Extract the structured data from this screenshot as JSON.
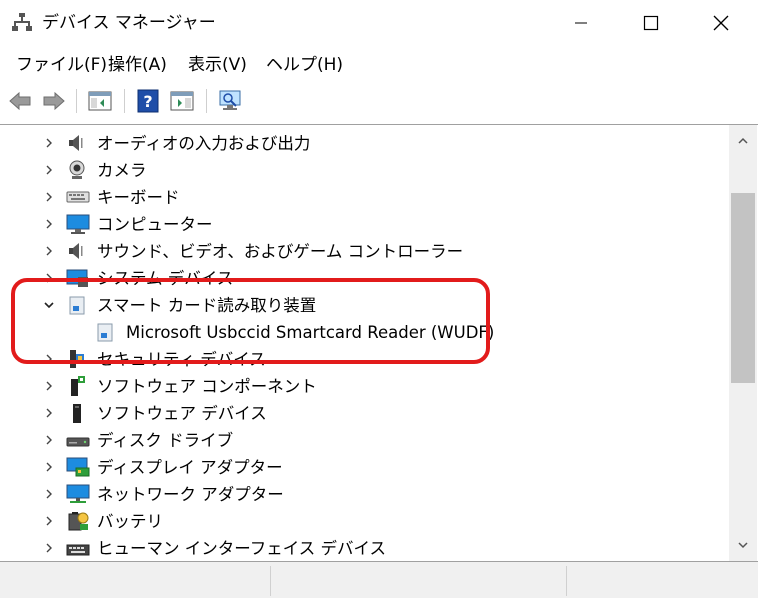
{
  "window": {
    "title": "デバイス マネージャー"
  },
  "menu": [
    {
      "label": "ファイル(F)"
    },
    {
      "label": "操作(A)"
    },
    {
      "label": "表示(V)"
    },
    {
      "label": "ヘルプ(H)"
    }
  ],
  "toolbar": {
    "buttons": [
      {
        "icon": "back-arrow-icon"
      },
      {
        "icon": "forward-arrow-icon"
      },
      {
        "icon": "show-hide-console-tree-icon"
      },
      {
        "icon": "help-icon"
      },
      {
        "icon": "action-pane-icon"
      },
      {
        "icon": "scan-hardware-changes-icon"
      }
    ]
  },
  "tree": {
    "items": [
      {
        "label": "オーディオの入力および出力",
        "icon": "speaker-icon",
        "expanded": false
      },
      {
        "label": "カメラ",
        "icon": "webcam-icon",
        "expanded": false
      },
      {
        "label": "キーボード",
        "icon": "keyboard-icon",
        "expanded": false
      },
      {
        "label": "コンピューター",
        "icon": "monitor-icon",
        "expanded": false
      },
      {
        "label": "サウンド、ビデオ、およびゲーム コントローラー",
        "icon": "speaker-icon",
        "expanded": false
      },
      {
        "label": "システム デバイス",
        "icon": "system-device-icon",
        "expanded": false
      },
      {
        "label": "スマート カード読み取り装置",
        "icon": "smart-card-reader-icon",
        "expanded": true
      },
      {
        "label": "Microsoft Usbccid Smartcard Reader (WUDF)",
        "icon": "smart-card-reader-icon",
        "child": true
      },
      {
        "label": "セキュリティ デバイス",
        "icon": "security-device-icon",
        "expanded": false
      },
      {
        "label": "ソフトウェア コンポーネント",
        "icon": "software-component-icon",
        "expanded": false
      },
      {
        "label": "ソフトウェア デバイス",
        "icon": "software-device-icon",
        "expanded": false
      },
      {
        "label": "ディスク ドライブ",
        "icon": "disk-drive-icon",
        "expanded": false
      },
      {
        "label": "ディスプレイ アダプター",
        "icon": "display-adapter-icon",
        "expanded": false
      },
      {
        "label": "ネットワーク アダプター",
        "icon": "network-adapter-icon",
        "expanded": false
      },
      {
        "label": "バッテリ",
        "icon": "battery-icon",
        "expanded": false
      },
      {
        "label": "ヒューマン インターフェイス デバイス",
        "icon": "hid-keyboard-icon",
        "expanded": false
      }
    ]
  },
  "colors": {
    "highlight": "#e21b1b",
    "accent": "#2b7cd3"
  }
}
